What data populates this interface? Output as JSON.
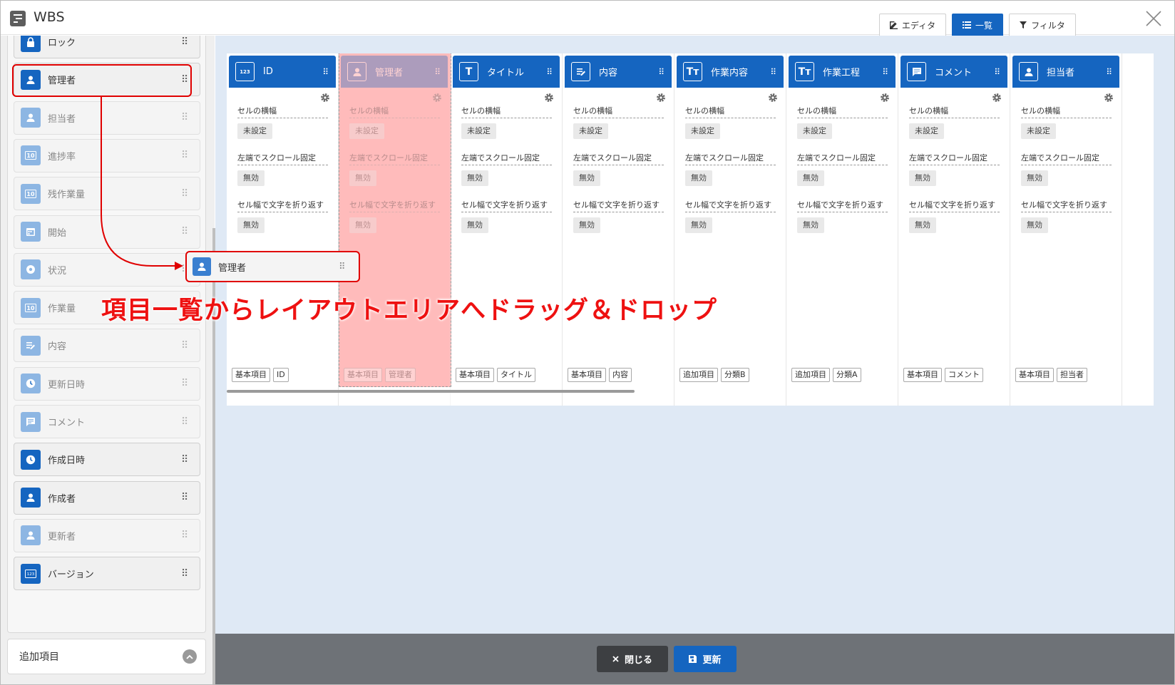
{
  "window": {
    "title": "WBS",
    "close_icon": "close-icon"
  },
  "header": {
    "tabs": [
      {
        "label": "エディタ",
        "icon": "edit-icon",
        "active": false
      },
      {
        "label": "一覧",
        "icon": "list-icon",
        "active": true
      },
      {
        "label": "フィルタ",
        "icon": "filter-icon",
        "active": false
      }
    ]
  },
  "sidebar": {
    "items": [
      {
        "label": "ロック",
        "icon": "lock-icon",
        "active": true
      },
      {
        "label": "管理者",
        "icon": "person-icon",
        "active": true
      },
      {
        "label": "担当者",
        "icon": "person-icon",
        "active": false
      },
      {
        "label": "進捗率",
        "icon": "number-icon",
        "active": false
      },
      {
        "label": "残作業量",
        "icon": "number-icon",
        "active": false
      },
      {
        "label": "開始",
        "icon": "calendar-icon",
        "active": false
      },
      {
        "label": "状況",
        "icon": "status-icon",
        "active": false
      },
      {
        "label": "作業量",
        "icon": "number-icon",
        "active": false
      },
      {
        "label": "内容",
        "icon": "text-icon",
        "active": false
      },
      {
        "label": "更新日時",
        "icon": "clock-icon",
        "active": false
      },
      {
        "label": "コメント",
        "icon": "comment-icon",
        "active": false
      },
      {
        "label": "作成日時",
        "icon": "clock-icon",
        "active": true
      },
      {
        "label": "作成者",
        "icon": "person-icon",
        "active": true
      },
      {
        "label": "更新者",
        "icon": "person-icon",
        "active": false
      },
      {
        "label": "バージョン",
        "icon": "id-icon",
        "active": true
      }
    ],
    "extra_section": {
      "label": "追加項目",
      "icon": "chevron-up-icon"
    }
  },
  "layout_area": {
    "cards": [
      {
        "title": "ID",
        "icon": "id-icon",
        "icon_text": "123",
        "tags": [
          "基本項目",
          "ID"
        ]
      },
      {
        "title": "管理者",
        "icon": "person-icon",
        "icon_text": "",
        "tags": [
          "基本項目",
          "管理者"
        ],
        "ghost": true
      },
      {
        "title": "タイトル",
        "icon": "text-t-icon",
        "icon_text": "T",
        "tags": [
          "基本項目",
          "タイトル"
        ]
      },
      {
        "title": "内容",
        "icon": "text-edit-icon",
        "icon_text": "",
        "tags": [
          "基本項目",
          "内容"
        ]
      },
      {
        "title": "作業内容",
        "icon": "text-tt-icon",
        "icon_text": "Tт",
        "tags": [
          "追加項目",
          "分類B"
        ]
      },
      {
        "title": "作業工程",
        "icon": "text-tt-icon",
        "icon_text": "Tт",
        "tags": [
          "追加項目",
          "分類A"
        ]
      },
      {
        "title": "コメント",
        "icon": "comment-icon",
        "icon_text": "",
        "tags": [
          "基本項目",
          "コメント"
        ]
      },
      {
        "title": "担当者",
        "icon": "person-icon",
        "icon_text": "",
        "tags": [
          "基本項目",
          "担当者"
        ]
      }
    ],
    "settings": [
      {
        "label": "セルの横幅",
        "value": "未設定"
      },
      {
        "label": "左端でスクロール固定",
        "value": "無効"
      },
      {
        "label": "セル幅で文字を折り返す",
        "value": "無効"
      }
    ]
  },
  "dragging": {
    "label": "管理者",
    "icon": "person-icon"
  },
  "annotation": {
    "text": "項目一覧からレイアウトエリアへドラッグ＆ドロップ"
  },
  "footer": {
    "close_label": "閉じる",
    "update_label": "更新"
  },
  "colors": {
    "primary": "#1565c0",
    "annotation": "#ee1111"
  }
}
